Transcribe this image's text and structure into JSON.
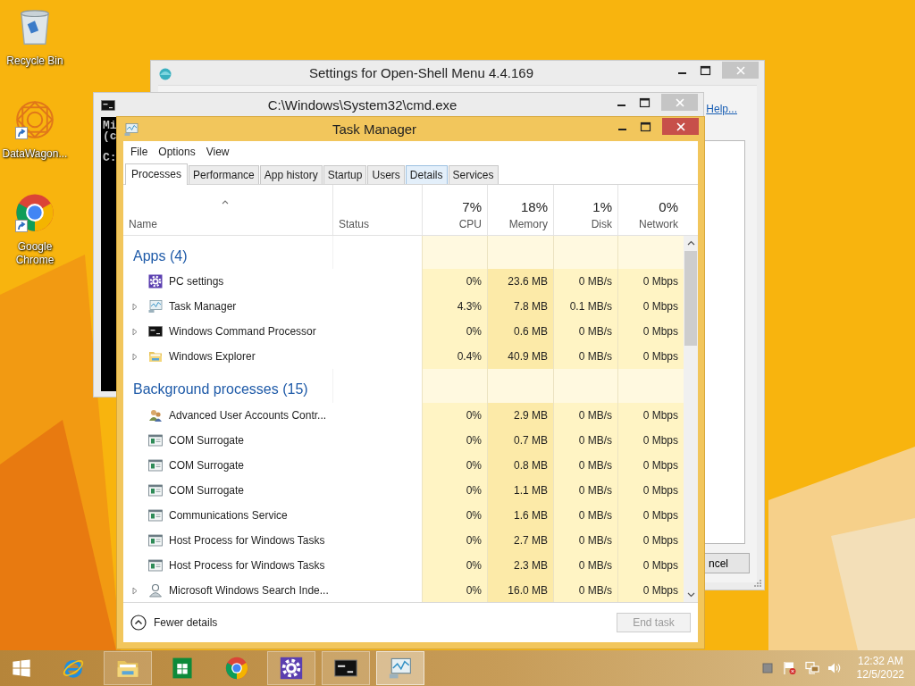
{
  "desktop_icons": [
    {
      "label": "Recycle Bin",
      "kind": "recycle-bin",
      "shortcut": false
    },
    {
      "label": "DataWagon...",
      "kind": "emblem",
      "shortcut": true
    },
    {
      "label": "Google Chrome",
      "kind": "chrome",
      "shortcut": true
    }
  ],
  "settings_window": {
    "title": "Settings for Open-Shell Menu 4.4.169",
    "active": false,
    "help_link": "Help...",
    "cancel_button": "ncel"
  },
  "console_window": {
    "title": "C:\\Windows\\System32\\cmd.exe",
    "active": false,
    "lines": [
      "Mi",
      "(c"
    ],
    "prompt": "C:"
  },
  "task_manager": {
    "title": "Task Manager",
    "active": true,
    "menu": [
      "File",
      "Options",
      "View"
    ],
    "tabs": [
      {
        "label": "Processes",
        "selected": true,
        "hovered": false
      },
      {
        "label": "Performance",
        "selected": false,
        "hovered": false
      },
      {
        "label": "App history",
        "selected": false,
        "hovered": false
      },
      {
        "label": "Startup",
        "selected": false,
        "hovered": false
      },
      {
        "label": "Users",
        "selected": false,
        "hovered": false
      },
      {
        "label": "Details",
        "selected": false,
        "hovered": true
      },
      {
        "label": "Services",
        "selected": false,
        "hovered": false
      }
    ],
    "columns": [
      {
        "label": "Name",
        "sorted": true
      },
      {
        "label": "Status"
      },
      {
        "label": "CPU",
        "total": "7%"
      },
      {
        "label": "Memory",
        "total": "18%"
      },
      {
        "label": "Disk",
        "total": "1%"
      },
      {
        "label": "Network",
        "total": "0%"
      }
    ],
    "groups": [
      {
        "title": "Apps (4)",
        "rows": [
          {
            "name": "PC settings",
            "kind": "gear",
            "expandable": false,
            "cpu": "0%",
            "memory": "23.6 MB",
            "disk": "0 MB/s",
            "network": "0 Mbps"
          },
          {
            "name": "Task Manager",
            "kind": "monitor",
            "expandable": true,
            "cpu": "4.3%",
            "memory": "7.8 MB",
            "disk": "0.1 MB/s",
            "network": "0 Mbps"
          },
          {
            "name": "Windows Command Processor",
            "kind": "console",
            "expandable": true,
            "cpu": "0%",
            "memory": "0.6 MB",
            "disk": "0 MB/s",
            "network": "0 Mbps"
          },
          {
            "name": "Windows Explorer",
            "kind": "folder",
            "expandable": true,
            "cpu": "0.4%",
            "memory": "40.9 MB",
            "disk": "0 MB/s",
            "network": "0 Mbps"
          }
        ]
      },
      {
        "title": "Background processes (15)",
        "rows": [
          {
            "name": "Advanced User Accounts Contr...",
            "kind": "users",
            "expandable": false,
            "cpu": "0%",
            "memory": "2.9 MB",
            "disk": "0 MB/s",
            "network": "0 Mbps"
          },
          {
            "name": "COM Surrogate",
            "kind": "service",
            "expandable": false,
            "cpu": "0%",
            "memory": "0.7 MB",
            "disk": "0 MB/s",
            "network": "0 Mbps"
          },
          {
            "name": "COM Surrogate",
            "kind": "service",
            "expandable": false,
            "cpu": "0%",
            "memory": "0.8 MB",
            "disk": "0 MB/s",
            "network": "0 Mbps"
          },
          {
            "name": "COM Surrogate",
            "kind": "service",
            "expandable": false,
            "cpu": "0%",
            "memory": "1.1 MB",
            "disk": "0 MB/s",
            "network": "0 Mbps"
          },
          {
            "name": "Communications Service",
            "kind": "service",
            "expandable": false,
            "cpu": "0%",
            "memory": "1.6 MB",
            "disk": "0 MB/s",
            "network": "0 Mbps"
          },
          {
            "name": "Host Process for Windows Tasks",
            "kind": "service",
            "expandable": false,
            "cpu": "0%",
            "memory": "2.7 MB",
            "disk": "0 MB/s",
            "network": "0 Mbps"
          },
          {
            "name": "Host Process for Windows Tasks",
            "kind": "service",
            "expandable": false,
            "cpu": "0%",
            "memory": "2.3 MB",
            "disk": "0 MB/s",
            "network": "0 Mbps"
          },
          {
            "name": "Microsoft Windows Search Inde...",
            "kind": "indexer",
            "expandable": true,
            "cpu": "0%",
            "memory": "16.0 MB",
            "disk": "0 MB/s",
            "network": "0 Mbps"
          }
        ]
      }
    ],
    "footer": {
      "toggle": "Fewer details",
      "end_task": {
        "label": "End task",
        "disabled": true
      }
    }
  },
  "taskbar": {
    "items": [
      {
        "kind": "start",
        "running": false,
        "active": false
      },
      {
        "kind": "ie",
        "running": false,
        "active": false
      },
      {
        "kind": "folder",
        "running": true,
        "active": false
      },
      {
        "kind": "store",
        "running": false,
        "active": false
      },
      {
        "kind": "chrome",
        "running": false,
        "active": false
      },
      {
        "kind": "gear",
        "running": true,
        "active": false
      },
      {
        "kind": "console",
        "running": true,
        "active": false
      },
      {
        "kind": "monitor",
        "running": true,
        "active": true
      }
    ],
    "tray_icons": [
      {
        "kind": "square"
      },
      {
        "kind": "flag"
      },
      {
        "kind": "network"
      },
      {
        "kind": "speaker"
      }
    ],
    "time": "12:32 AM",
    "date": "12/5/2022"
  }
}
